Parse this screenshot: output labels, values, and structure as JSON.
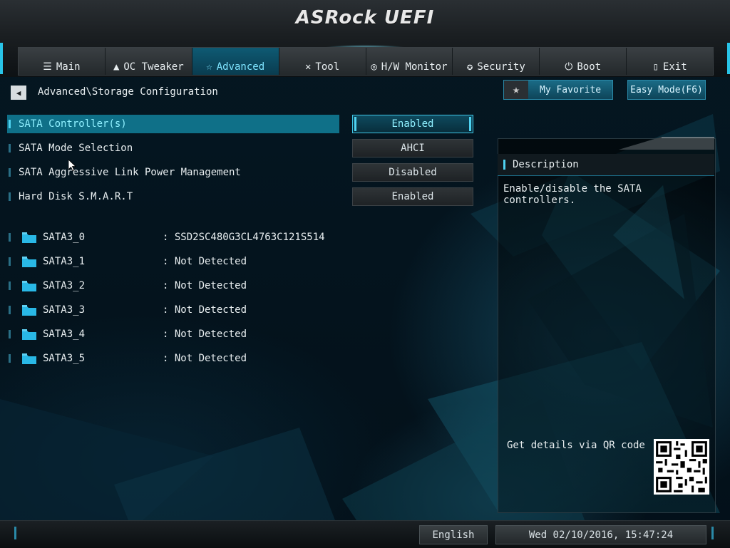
{
  "app": {
    "logo_text": "ASRock UEFI"
  },
  "tabs": [
    {
      "label": "Main",
      "icon": "list-icon",
      "active": false
    },
    {
      "label": "OC Tweaker",
      "icon": "rocket-icon",
      "active": false
    },
    {
      "label": "Advanced",
      "icon": "star-icon",
      "active": true
    },
    {
      "label": "Tool",
      "icon": "tools-icon",
      "active": false
    },
    {
      "label": "H/W Monitor",
      "icon": "monitor-icon",
      "active": false
    },
    {
      "label": "Security",
      "icon": "shield-icon",
      "active": false
    },
    {
      "label": "Boot",
      "icon": "power-icon",
      "active": false
    },
    {
      "label": "Exit",
      "icon": "exit-icon",
      "active": false
    }
  ],
  "breadcrumb": {
    "path": "Advanced\\Storage Configuration"
  },
  "buttons": {
    "favorite": "My Favorite",
    "easy_mode": "Easy Mode(F6)"
  },
  "options": [
    {
      "label": "SATA Controller(s)",
      "value": "Enabled",
      "selected": true
    },
    {
      "label": "SATA Mode Selection",
      "value": "AHCI",
      "selected": false
    },
    {
      "label": "SATA Aggressive Link Power Management",
      "value": "Disabled",
      "selected": false
    },
    {
      "label": "Hard Disk S.M.A.R.T",
      "value": "Enabled",
      "selected": false
    }
  ],
  "sata_ports": [
    {
      "name": "SATA3_0",
      "status": ": SSD2SC480G3CL4763C121S514"
    },
    {
      "name": "SATA3_1",
      "status": ": Not Detected"
    },
    {
      "name": "SATA3_2",
      "status": ": Not Detected"
    },
    {
      "name": "SATA3_3",
      "status": ": Not Detected"
    },
    {
      "name": "SATA3_4",
      "status": ": Not Detected"
    },
    {
      "name": "SATA3_5",
      "status": ": Not Detected"
    }
  ],
  "description": {
    "title": "Description",
    "text": "Enable/disable the SATA controllers.",
    "qr_label": "Get details via QR code"
  },
  "footer": {
    "language": "English",
    "datetime": "Wed 02/10/2016, 15:47:24"
  },
  "colors": {
    "accent": "#28c4e8",
    "selected_row": "#0f7088",
    "selected_text": "#8ff0ff"
  }
}
